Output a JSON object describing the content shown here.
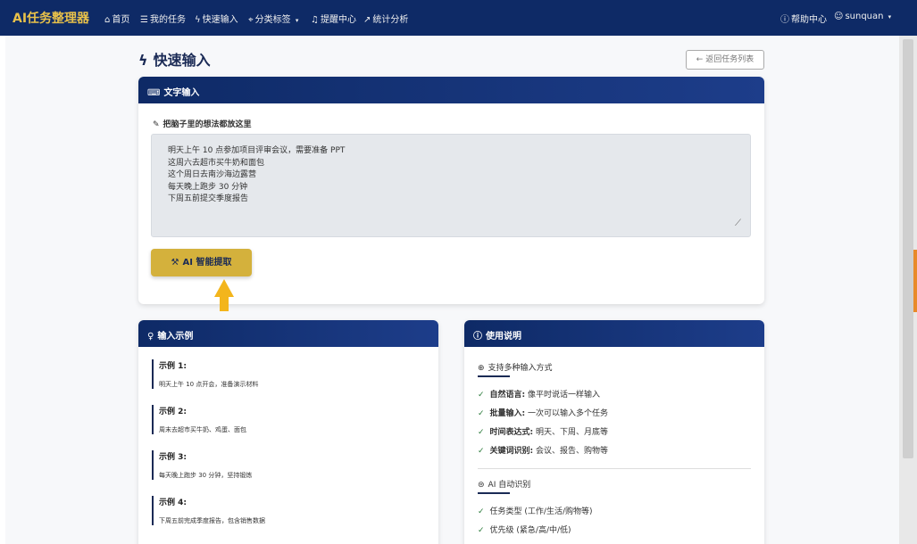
{
  "nav": {
    "brand": "AI任务整理器",
    "items": [
      {
        "icon": "home-icon",
        "label": "首页"
      },
      {
        "icon": "list-icon",
        "label": "我的任务"
      },
      {
        "icon": "bolt-icon",
        "label": "快速输入"
      },
      {
        "icon": "tag-icon",
        "label": "分类标签"
      },
      {
        "icon": "bell-icon",
        "label": "提醒中心"
      },
      {
        "icon": "chart-icon",
        "label": "统计分析"
      }
    ],
    "help": "帮助中心",
    "user": "sunquan"
  },
  "page": {
    "title": "快速输入",
    "back_button": "返回任务列表"
  },
  "text_input_card": {
    "header": "文字输入",
    "label": "把脑子里的想法都放这里",
    "lines": [
      "明天上午 10 点参加项目评审会议，需要准备 PPT",
      "这周六去超市买牛奶和面包",
      "这个周日去南沙海边露营",
      "每天晚上跑步 30 分钟",
      "下周五前提交季度报告"
    ],
    "ai_button": "AI 智能提取"
  },
  "examples_card": {
    "header": "输入示例",
    "items": [
      {
        "title": "示例 1:",
        "desc": "明天上午 10 点开会，准备演示材料"
      },
      {
        "title": "示例 2:",
        "desc": "周末去超市买牛奶、鸡蛋、面包"
      },
      {
        "title": "示例 3:",
        "desc": "每天晚上跑步 30 分钟，坚持锻炼"
      },
      {
        "title": "示例 4:",
        "desc": "下周五前完成季度报告，包含销售数据"
      }
    ]
  },
  "usage_card": {
    "header": "使用说明",
    "section1_title": "支持多种输入方式",
    "section1_items": [
      {
        "key": "自然语言:",
        "val": " 像平时说话一样输入"
      },
      {
        "key": "批量输入:",
        "val": " 一次可以输入多个任务"
      },
      {
        "key": "时间表达式:",
        "val": " 明天、下周、月底等"
      },
      {
        "key": "关键词识别:",
        "val": " 会议、报告、购物等"
      }
    ],
    "section2_title": "AI 自动识别",
    "section2_items": [
      "任务类型 (工作/生活/购物等)",
      "优先级 (紧急/高/中/低)"
    ]
  }
}
